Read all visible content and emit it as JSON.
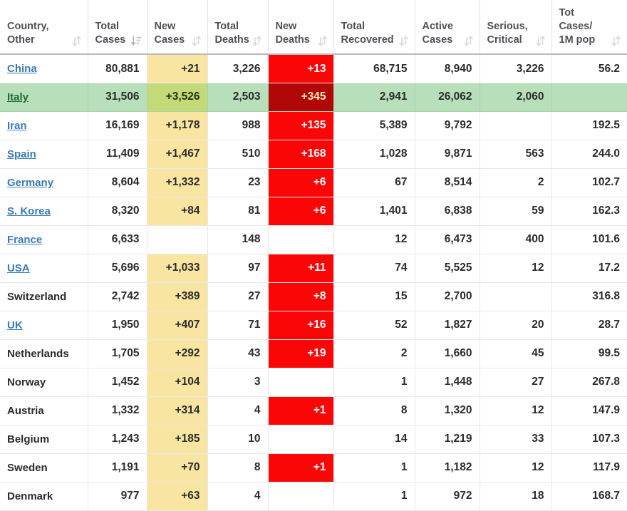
{
  "table": {
    "columns": [
      {
        "id": "country",
        "line1": "Country,",
        "line2": "Other",
        "sort_icon": "sort-both-icon",
        "align": "left"
      },
      {
        "id": "total_cases",
        "line1": "Total",
        "line2": "Cases",
        "sort_icon": "sort-descending-icon",
        "align": "right"
      },
      {
        "id": "new_cases",
        "line1": "New",
        "line2": "Cases",
        "sort_icon": "sort-both-icon",
        "align": "right"
      },
      {
        "id": "total_deaths",
        "line1": "Total",
        "line2": "Deaths",
        "sort_icon": "sort-both-icon",
        "align": "right"
      },
      {
        "id": "new_deaths",
        "line1": "New",
        "line2": "Deaths",
        "sort_icon": "sort-both-icon",
        "align": "right"
      },
      {
        "id": "total_recovered",
        "line1": "Total",
        "line2": "Recovered",
        "sort_icon": "sort-both-icon",
        "align": "right"
      },
      {
        "id": "active_cases",
        "line1": "Active",
        "line2": "Cases",
        "sort_icon": "sort-both-icon",
        "align": "right"
      },
      {
        "id": "serious_critical",
        "line1": "Serious,",
        "line2": "Critical",
        "sort_icon": "sort-both-icon",
        "align": "right"
      },
      {
        "id": "tot_cases_1m",
        "line1": "Tot Cases/",
        "line2": "1M pop",
        "sort_icon": "sort-both-icon",
        "align": "right"
      }
    ],
    "rows": [
      {
        "country": "China",
        "link": true,
        "highlight": false,
        "total_cases": "80,881",
        "new_cases": "+21",
        "total_deaths": "3,226",
        "new_deaths": "+13",
        "total_recovered": "68,715",
        "active_cases": "8,940",
        "serious_critical": "3,226",
        "tot_cases_1m": "56.2"
      },
      {
        "country": "Italy",
        "link": true,
        "highlight": true,
        "total_cases": "31,506",
        "new_cases": "+3,526",
        "total_deaths": "2,503",
        "new_deaths": "+345",
        "total_recovered": "2,941",
        "active_cases": "26,062",
        "serious_critical": "2,060",
        "tot_cases_1m": ""
      },
      {
        "country": "Iran",
        "link": true,
        "highlight": false,
        "total_cases": "16,169",
        "new_cases": "+1,178",
        "total_deaths": "988",
        "new_deaths": "+135",
        "total_recovered": "5,389",
        "active_cases": "9,792",
        "serious_critical": "",
        "tot_cases_1m": "192.5"
      },
      {
        "country": "Spain",
        "link": true,
        "highlight": false,
        "total_cases": "11,409",
        "new_cases": "+1,467",
        "total_deaths": "510",
        "new_deaths": "+168",
        "total_recovered": "1,028",
        "active_cases": "9,871",
        "serious_critical": "563",
        "tot_cases_1m": "244.0"
      },
      {
        "country": "Germany",
        "link": true,
        "highlight": false,
        "total_cases": "8,604",
        "new_cases": "+1,332",
        "total_deaths": "23",
        "new_deaths": "+6",
        "total_recovered": "67",
        "active_cases": "8,514",
        "serious_critical": "2",
        "tot_cases_1m": "102.7"
      },
      {
        "country": "S. Korea",
        "link": true,
        "highlight": false,
        "total_cases": "8,320",
        "new_cases": "+84",
        "total_deaths": "81",
        "new_deaths": "+6",
        "total_recovered": "1,401",
        "active_cases": "6,838",
        "serious_critical": "59",
        "tot_cases_1m": "162.3"
      },
      {
        "country": "France",
        "link": true,
        "highlight": false,
        "total_cases": "6,633",
        "new_cases": "",
        "total_deaths": "148",
        "new_deaths": "",
        "total_recovered": "12",
        "active_cases": "6,473",
        "serious_critical": "400",
        "tot_cases_1m": "101.6"
      },
      {
        "country": "USA",
        "link": true,
        "highlight": false,
        "total_cases": "5,696",
        "new_cases": "+1,033",
        "total_deaths": "97",
        "new_deaths": "+11",
        "total_recovered": "74",
        "active_cases": "5,525",
        "serious_critical": "12",
        "tot_cases_1m": "17.2"
      },
      {
        "country": "Switzerland",
        "link": false,
        "highlight": false,
        "total_cases": "2,742",
        "new_cases": "+389",
        "total_deaths": "27",
        "new_deaths": "+8",
        "total_recovered": "15",
        "active_cases": "2,700",
        "serious_critical": "",
        "tot_cases_1m": "316.8"
      },
      {
        "country": "UK",
        "link": true,
        "highlight": false,
        "total_cases": "1,950",
        "new_cases": "+407",
        "total_deaths": "71",
        "new_deaths": "+16",
        "total_recovered": "52",
        "active_cases": "1,827",
        "serious_critical": "20",
        "tot_cases_1m": "28.7"
      },
      {
        "country": "Netherlands",
        "link": false,
        "highlight": false,
        "total_cases": "1,705",
        "new_cases": "+292",
        "total_deaths": "43",
        "new_deaths": "+19",
        "total_recovered": "2",
        "active_cases": "1,660",
        "serious_critical": "45",
        "tot_cases_1m": "99.5"
      },
      {
        "country": "Norway",
        "link": false,
        "highlight": false,
        "total_cases": "1,452",
        "new_cases": "+104",
        "total_deaths": "3",
        "new_deaths": "",
        "total_recovered": "1",
        "active_cases": "1,448",
        "serious_critical": "27",
        "tot_cases_1m": "267.8"
      },
      {
        "country": "Austria",
        "link": false,
        "highlight": false,
        "total_cases": "1,332",
        "new_cases": "+314",
        "total_deaths": "4",
        "new_deaths": "+1",
        "total_recovered": "8",
        "active_cases": "1,320",
        "serious_critical": "12",
        "tot_cases_1m": "147.9"
      },
      {
        "country": "Belgium",
        "link": false,
        "highlight": false,
        "total_cases": "1,243",
        "new_cases": "+185",
        "total_deaths": "10",
        "new_deaths": "",
        "total_recovered": "14",
        "active_cases": "1,219",
        "serious_critical": "33",
        "tot_cases_1m": "107.3"
      },
      {
        "country": "Sweden",
        "link": false,
        "highlight": false,
        "total_cases": "1,191",
        "new_cases": "+70",
        "total_deaths": "8",
        "new_deaths": "+1",
        "total_recovered": "1",
        "active_cases": "1,182",
        "serious_critical": "12",
        "tot_cases_1m": "117.9"
      },
      {
        "country": "Denmark",
        "link": false,
        "highlight": false,
        "total_cases": "977",
        "new_cases": "+63",
        "total_deaths": "4",
        "new_deaths": "",
        "total_recovered": "1",
        "active_cases": "972",
        "serious_critical": "18",
        "tot_cases_1m": "168.7"
      }
    ]
  },
  "colors": {
    "new_cases_bg": "#f9e5a2",
    "new_deaths_bg": "#fa0606",
    "highlight_row_bg": "#b7dfb9",
    "highlight_new_cases_bg": "#c3da79",
    "highlight_new_deaths_bg": "#b00808",
    "link": "#3a7ab5",
    "text": "#2b2b2b",
    "header_text": "#4d5055"
  }
}
